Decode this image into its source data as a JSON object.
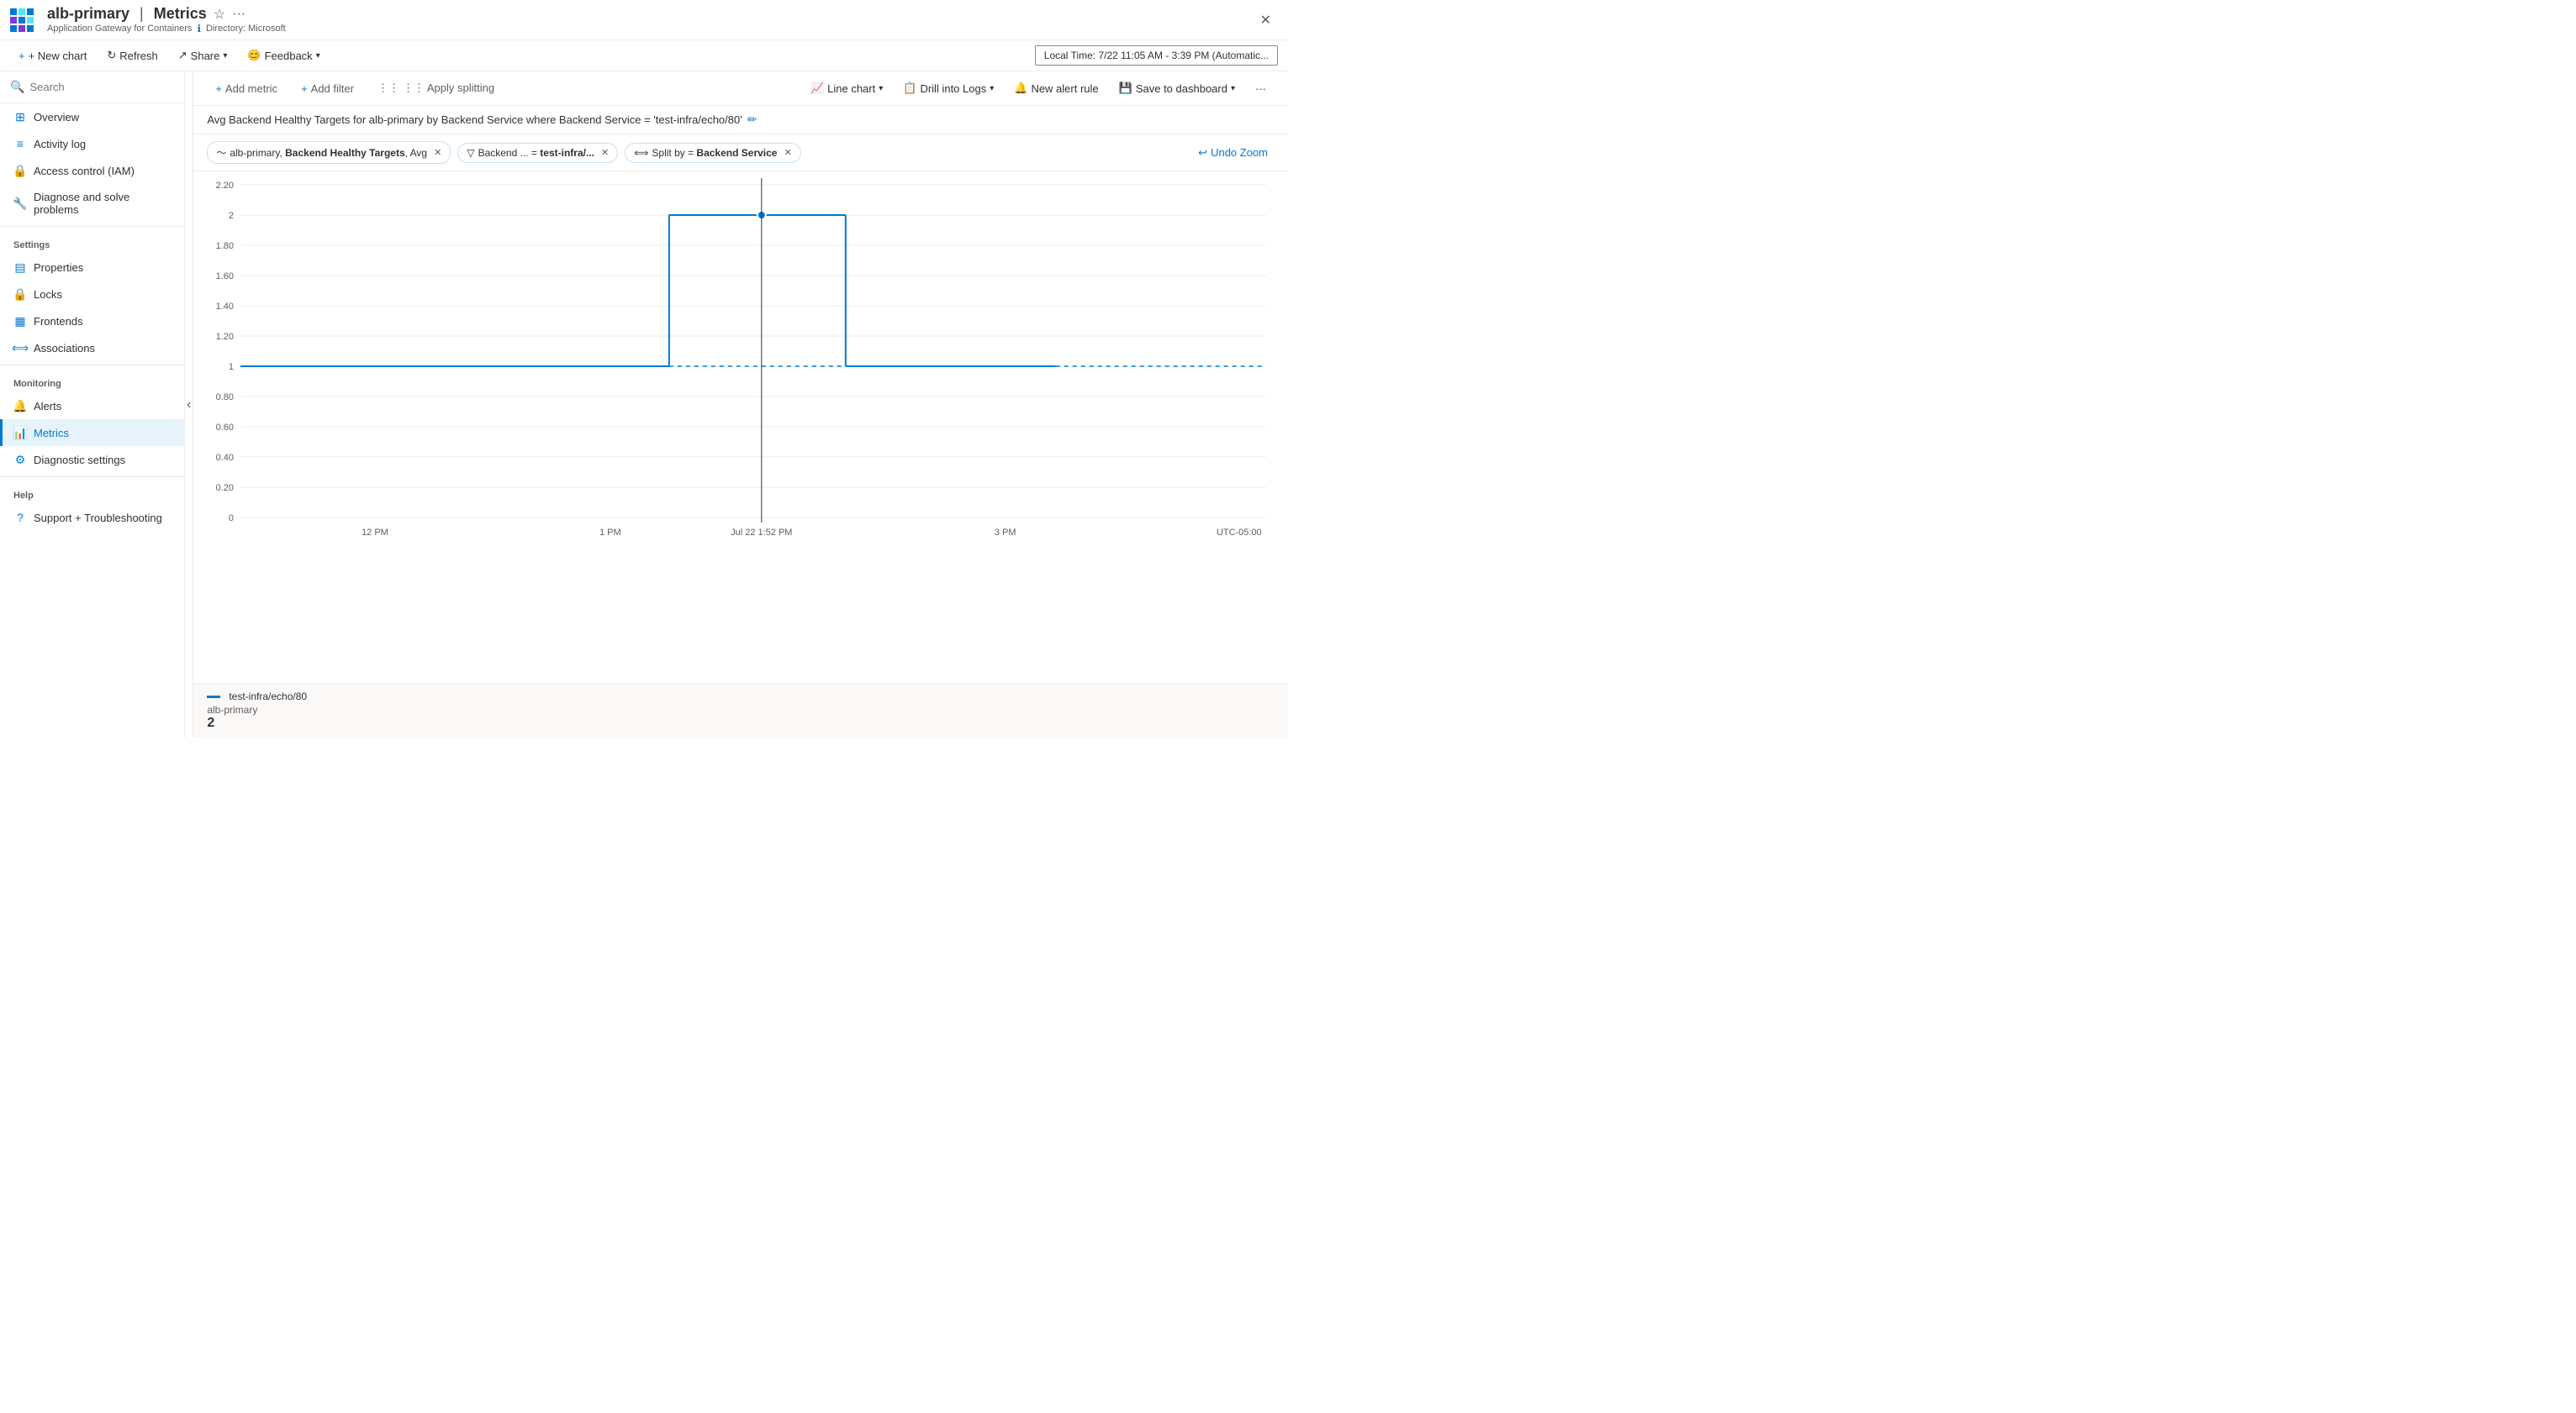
{
  "header": {
    "resource_name": "alb-primary",
    "separator": "|",
    "page_name": "Metrics",
    "subtitle_resource": "Application Gateway for Containers",
    "directory_label": "Directory: Microsoft",
    "close_label": "✕"
  },
  "toolbar": {
    "new_chart": "+ New chart",
    "refresh": "Refresh",
    "share": "Share",
    "feedback": "Feedback",
    "time_range": "Local Time: 7/22 11:05 AM - 3:39 PM (Automatic..."
  },
  "sidebar": {
    "search_placeholder": "Search",
    "items": [
      {
        "id": "overview",
        "label": "Overview",
        "icon": "⊞"
      },
      {
        "id": "activity-log",
        "label": "Activity log",
        "icon": "≡"
      },
      {
        "id": "access-control",
        "label": "Access control (IAM)",
        "icon": "🔒"
      },
      {
        "id": "diagnose",
        "label": "Diagnose and solve problems",
        "icon": "🔧"
      }
    ],
    "settings_header": "Settings",
    "settings_items": [
      {
        "id": "properties",
        "label": "Properties",
        "icon": "≡"
      },
      {
        "id": "locks",
        "label": "Locks",
        "icon": "🔒"
      },
      {
        "id": "frontends",
        "label": "Frontends",
        "icon": "▤"
      },
      {
        "id": "associations",
        "label": "Associations",
        "icon": "⟺"
      }
    ],
    "monitoring_header": "Monitoring",
    "monitoring_items": [
      {
        "id": "alerts",
        "label": "Alerts",
        "icon": "🔔"
      },
      {
        "id": "metrics",
        "label": "Metrics",
        "icon": "📊",
        "active": true
      },
      {
        "id": "diagnostic-settings",
        "label": "Diagnostic settings",
        "icon": "⚙"
      }
    ],
    "help_header": "Help",
    "help_items": [
      {
        "id": "support",
        "label": "Support + Troubleshooting",
        "icon": "?"
      }
    ]
  },
  "metrics": {
    "toolbar": {
      "add_metric": "+ Add metric",
      "add_filter": "+ Add filter",
      "apply_splitting": "⋮⋮ Apply splitting",
      "line_chart": "Line chart",
      "drill_into_logs": "Drill into Logs",
      "new_alert_rule": "New alert rule",
      "save_to_dashboard": "Save to dashboard",
      "more": "..."
    },
    "description": "Avg Backend Healthy Targets for alb-primary by Backend Service where Backend Service = 'test-infra/echo/80'",
    "chips": [
      {
        "id": "metric-chip",
        "icon": "〜",
        "text": "alb-primary, Backend Healthy Targets, Avg"
      },
      {
        "id": "filter-chip",
        "icon": "▽",
        "text": "Backend ... = test-infra/..."
      },
      {
        "id": "split-chip",
        "icon": "⟺",
        "text": "Split by = Backend Service"
      }
    ],
    "undo_zoom": "↩ Undo Zoom",
    "chart": {
      "y_labels": [
        "2.20",
        "2",
        "1.80",
        "1.60",
        "1.40",
        "1.20",
        "1",
        "0.80",
        "0.60",
        "0.40",
        "0.20",
        "0"
      ],
      "x_labels": [
        "12 PM",
        "1 PM",
        "Jul 22 1:52 PM",
        "3 PM"
      ],
      "timezone": "UTC-05:00",
      "cursor_label": "Jul 22 1:52 PM",
      "data_series": [
        {
          "name": "test-infra/echo/80",
          "color": "#0078d4",
          "style": "solid",
          "points": [
            [
              0,
              1
            ],
            [
              520,
              1
            ],
            [
              521,
              2
            ],
            [
              730,
              2
            ],
            [
              731,
              1
            ],
            [
              1050,
              1
            ]
          ],
          "value": "2"
        },
        {
          "name": "test-infra/echo/80 (dashed)",
          "color": "#0078d4",
          "style": "dashed"
        }
      ]
    },
    "legend": {
      "name": "test-infra/echo/80",
      "sub": "alb-primary",
      "value": "2"
    }
  }
}
